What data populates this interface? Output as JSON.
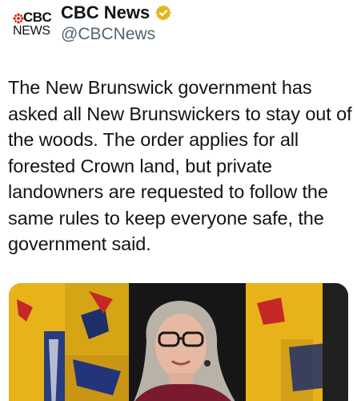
{
  "account": {
    "avatar_logo_top": "CBC",
    "avatar_logo_bottom": "NEWS",
    "display_name": "CBC News",
    "verified_icon": "gold-verified-badge-icon",
    "handle": "@CBCNews"
  },
  "tweet": {
    "text": "The New Brunswick government has asked all New Brunswickers to stay out of the woods. The order applies for all forested Crown land, but private landowners are requested to follow the same rules to keep everyone safe, the government said."
  },
  "colors": {
    "verified_gold": "#E2B719",
    "cbc_red": "#E60505",
    "handle_gray": "#536471",
    "flag_yellow": "#F2C01E"
  }
}
